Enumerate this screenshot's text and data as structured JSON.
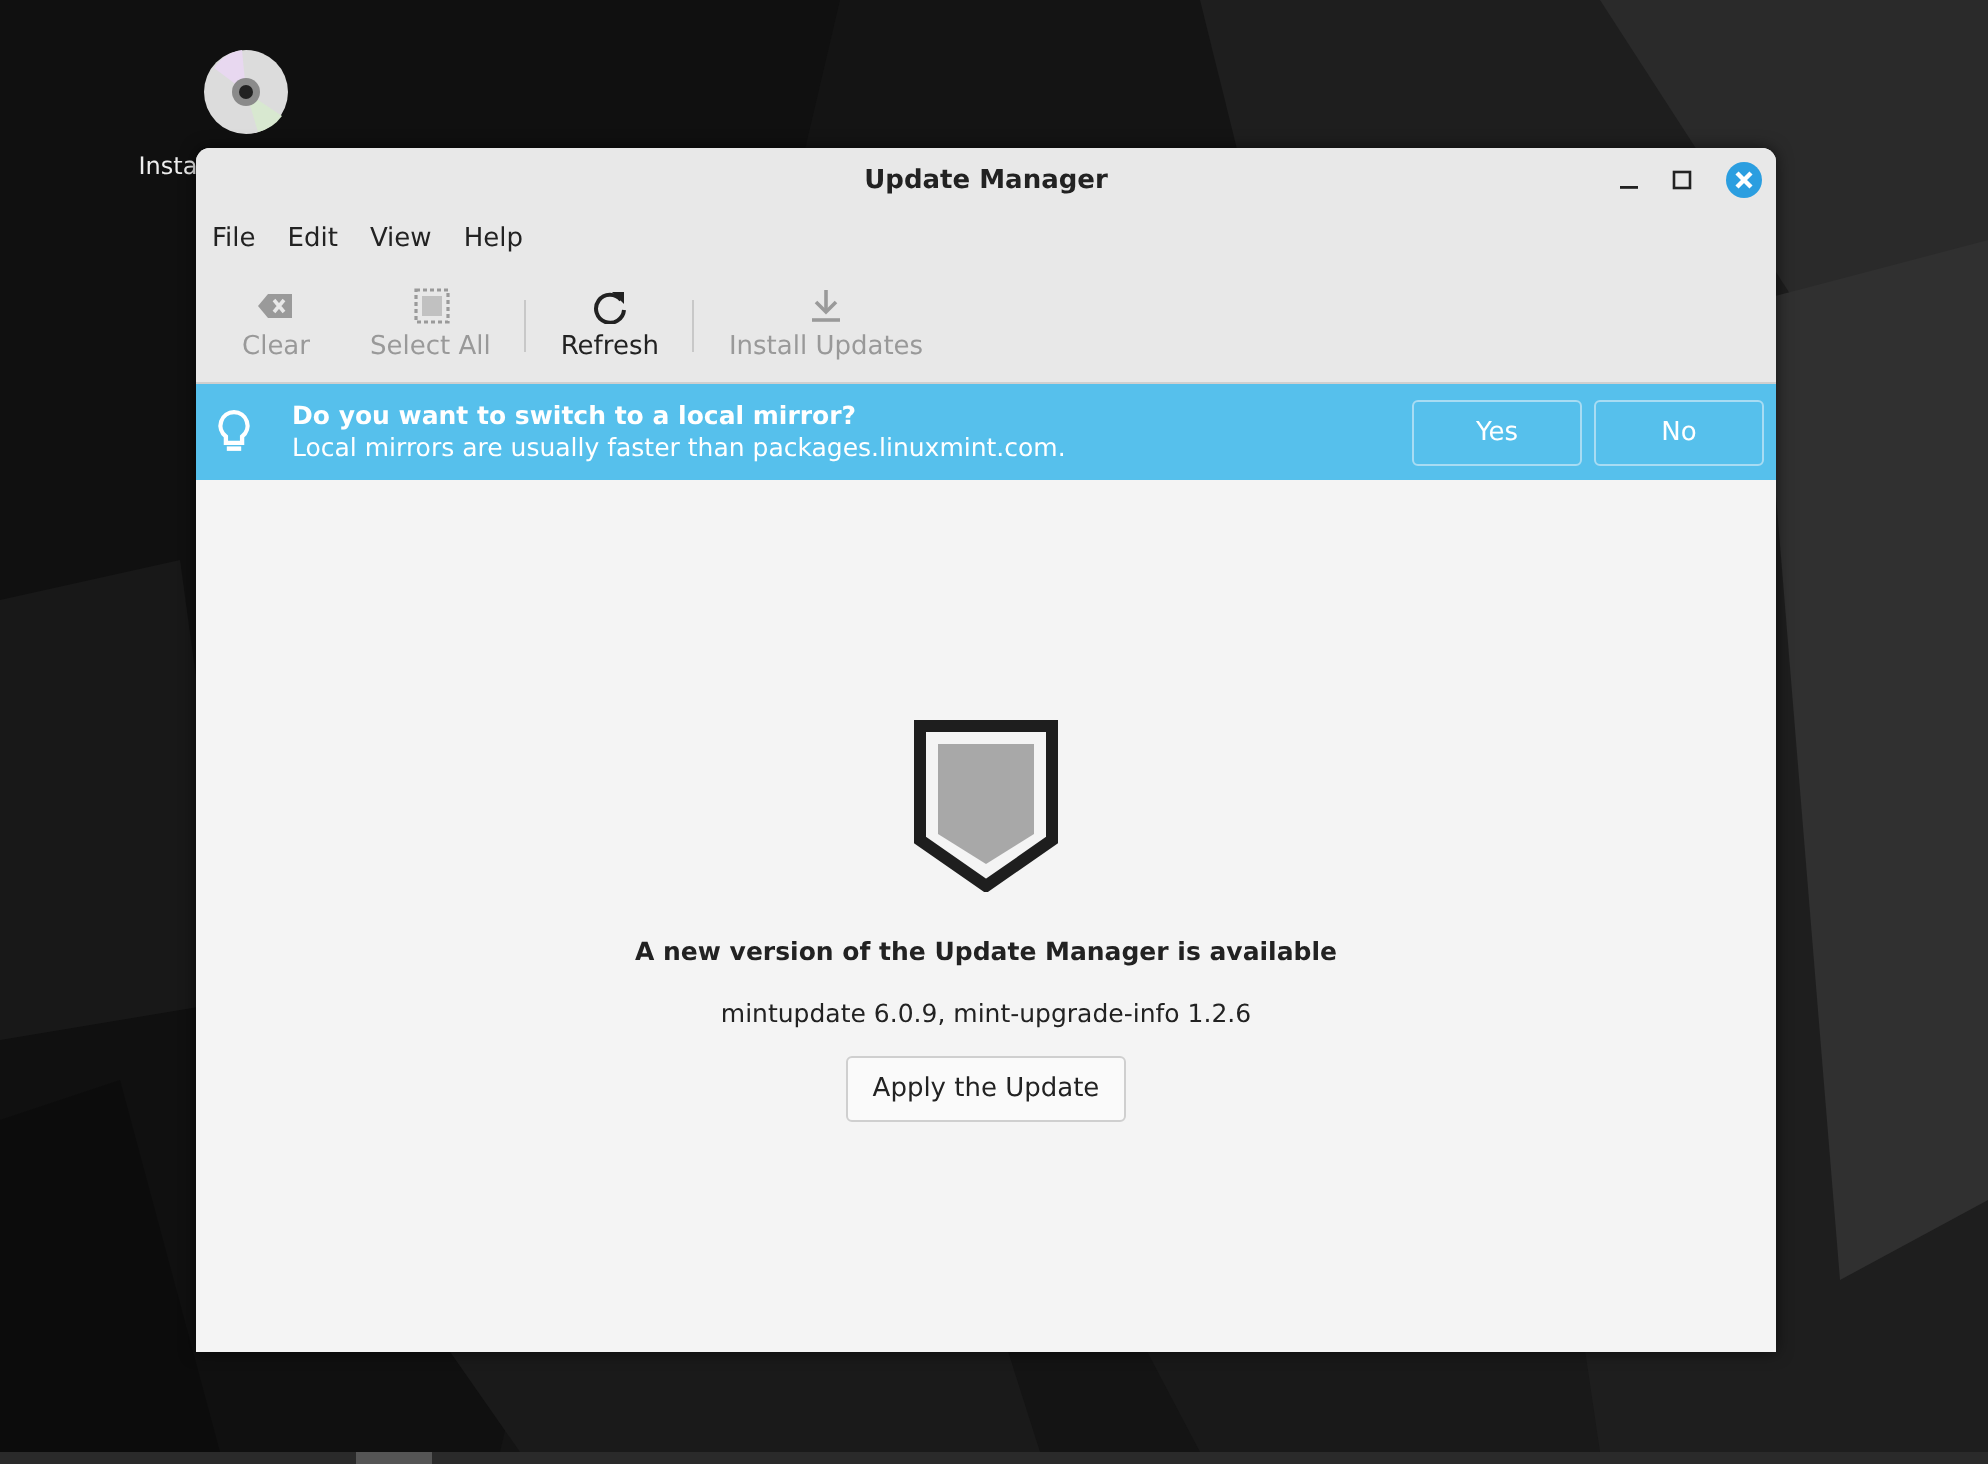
{
  "desktop": {
    "icons": [
      {
        "label": "Insta"
      }
    ]
  },
  "window": {
    "title": "Update Manager"
  },
  "menu": [
    "File",
    "Edit",
    "View",
    "Help"
  ],
  "toolbar": [
    {
      "kind": "clear",
      "label": "Clear",
      "disabled": true
    },
    {
      "kind": "select-all",
      "label": "Select All",
      "disabled": true
    },
    {
      "kind": "separator"
    },
    {
      "kind": "refresh",
      "label": "Refresh",
      "disabled": false
    },
    {
      "kind": "separator"
    },
    {
      "kind": "install",
      "label": "Install Updates",
      "disabled": true
    }
  ],
  "infobar": {
    "title": "Do you want to switch to a local mirror?",
    "message": "Local mirrors are usually faster than packages.linuxmint.com.",
    "buttons": [
      "Yes",
      "No"
    ]
  },
  "content": {
    "heading": "A new version of the Update Manager is available",
    "detail": "mintupdate 6.0.9, mint-upgrade-info 1.2.6",
    "button": "Apply the Update"
  }
}
